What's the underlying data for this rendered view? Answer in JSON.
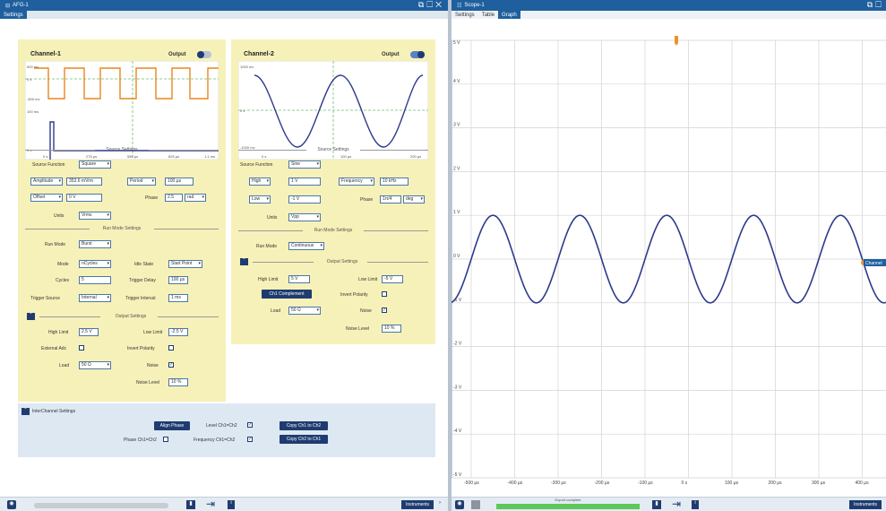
{
  "afg": {
    "title": "AFG-1",
    "tab": "Settings",
    "ch1": {
      "title": "Channel-1",
      "output_label": "Output",
      "y_ticks": [
        "500 mv",
        "0 v",
        "-500 mv",
        "100 ms",
        "0 v"
      ],
      "x_ticks": [
        "0 s",
        "275 µs",
        "550 µs",
        "825 µs",
        "1.1 ms"
      ],
      "source_settings": "Source Settings",
      "source_function_label": "Source Function",
      "source_function": "Square",
      "amplitude_sel": "Amplitude",
      "amplitude": "353.6 mVrm",
      "period_sel": "Period",
      "period": "100 µs",
      "offset_sel": "Offset",
      "offset": "0 V",
      "phase_label": "Phase",
      "phase": "2.5",
      "phase_unit": "rad",
      "units_label": "Units",
      "units": "Vrms",
      "run_mode_settings": "Run Mode Settings",
      "run_mode_label": "Run Mode",
      "run_mode": "Burst",
      "mode_label": "Mode",
      "mode": "nCycles",
      "idle_state_label": "Idle State",
      "idle_state": "Start Point",
      "cycles_label": "Cycles",
      "cycles": "5",
      "trigger_delay_label": "Trigger Delay",
      "trigger_delay": "100 µs",
      "trigger_source_label": "Trigger Source",
      "trigger_source": "Internal",
      "trigger_interval_label": "Trigger Interval",
      "trigger_interval": "1 ms",
      "output_settings": "Output Settings",
      "high_limit_label": "High Limit",
      "high_limit": "2.5 V",
      "low_limit_label": "Low Limit",
      "low_limit": "-2.5 V",
      "external_adc_label": "External Adc",
      "invert_polarity_label": "Invert Polarity",
      "load_label": "Load",
      "load": "50 Ω",
      "noise_label": "Noise",
      "noise_level_label": "Noise Level",
      "noise_level": "10 %"
    },
    "ch2": {
      "title": "Channel-2",
      "output_label": "Output",
      "y_ticks": [
        "1000 mv",
        "0 v",
        "-1000 mv"
      ],
      "x_ticks": [
        "0 s",
        "100 µs",
        "200 µs"
      ],
      "source_settings": "Source Settings",
      "source_function_label": "Source Function",
      "source_function": "Sine",
      "high_sel": "High",
      "high": "1 V",
      "frequency_sel": "Frequency",
      "frequency": "10 kHz",
      "low_sel": "Low",
      "low": "-1 V",
      "phase_label": "Phase",
      "phase": "1π/4",
      "phase_unit": "deg",
      "units_label": "Units",
      "units": "Vpp",
      "run_mode_settings": "Run Mode Settings",
      "run_mode_label": "Run Mode",
      "run_mode": "Continuous",
      "output_settings": "Output Settings",
      "high_limit_label": "High Limit",
      "high_limit": "5 V",
      "low_limit_label": "Low Limit",
      "low_limit": "-5 V",
      "complement_button": "Ch1 Complement",
      "invert_polarity_label": "Invert Polarity",
      "load_label": "Load",
      "load": "50 Ω",
      "noise_label": "Noise",
      "noise_level_label": "Noise Level",
      "noise_level": "10 %"
    },
    "inter": {
      "title": "InterChannel Settings",
      "align_phase": "Align Phase",
      "phase_label": "Phase Ch1=Ch2",
      "level_label": "Level Ch1=Ch2",
      "frequency_label": "Frequency Ch1=Ch2",
      "copy12": "Copy Ch1 to Ch2",
      "copy21": "Copy Ch2 to Ch1"
    },
    "instruments": "Instruments"
  },
  "scope": {
    "title": "Scope-1",
    "tabs": [
      "Settings",
      "Table",
      "Graph"
    ],
    "y_ticks": [
      "5 V",
      "4 V",
      "3 V",
      "2 V",
      "1 V",
      "0 V",
      "-1 V",
      "-2 V",
      "-3 V",
      "-4 V",
      "-5 V"
    ],
    "x_ticks": [
      "-500 µs",
      "-400 µs",
      "-300 µs",
      "-200 µs",
      "-100 µs",
      "0 s",
      "100 µs",
      "200 µs",
      "300 µs",
      "400 µs"
    ],
    "marker": "Channel",
    "export_status": "Export complete",
    "instruments": "Instruments",
    "trace_color": "#2e3a8c"
  }
}
